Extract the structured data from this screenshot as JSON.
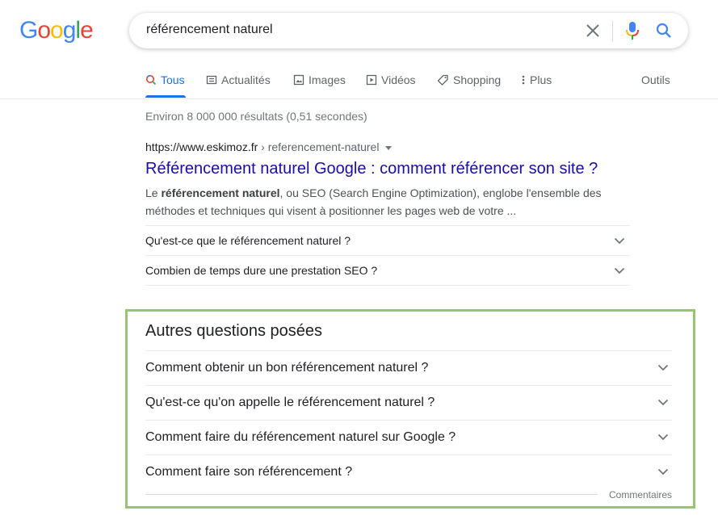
{
  "logo": {
    "letters": [
      "G",
      "o",
      "o",
      "g",
      "l",
      "e"
    ],
    "colors": [
      "#4285F4",
      "#EA4335",
      "#FBBC05",
      "#4285F4",
      "#34A853",
      "#EA4335"
    ]
  },
  "search": {
    "query": "référencement naturel",
    "clear_icon": "close-icon",
    "mic_icon": "microphone-icon",
    "search_icon": "search-icon"
  },
  "tabs": [
    {
      "label": "Tous",
      "icon": "search-icon",
      "active": true
    },
    {
      "label": "Actualités",
      "icon": "news-icon"
    },
    {
      "label": "Images",
      "icon": "image-icon"
    },
    {
      "label": "Vidéos",
      "icon": "video-icon"
    },
    {
      "label": "Shopping",
      "icon": "tag-icon"
    },
    {
      "label": "Plus",
      "icon": "more-vert-icon"
    }
  ],
  "tools_label": "Outils",
  "stats": "Environ 8 000 000 résultats (0,51 secondes)",
  "result": {
    "domain": "https://www.eskimoz.fr",
    "path": " › referencement-naturel",
    "title": "Référencement naturel Google : comment référencer son site ?",
    "snippet_pre": "Le ",
    "snippet_bold": "référencement naturel",
    "snippet_post": ", ou SEO (Search Engine Optimization), englobe l'ensemble des méthodes et techniques qui visent à positionner les pages web de votre ...",
    "sitelinks": [
      " Qu'est-ce que le référencement naturel ?",
      "Combien de temps dure une prestation SEO ?"
    ]
  },
  "paa": {
    "title": "Autres questions posées",
    "questions": [
      "Comment obtenir un bon référencement naturel ?",
      "Qu'est-ce qu'on appelle le référencement naturel ?",
      "Comment faire du référencement naturel sur Google ?",
      "Comment faire son référencement ?"
    ],
    "feedback": "Commentaires",
    "highlight_color": "#96c574"
  },
  "colors": {
    "link": "#1a0dab",
    "accent": "#1a73e8"
  }
}
